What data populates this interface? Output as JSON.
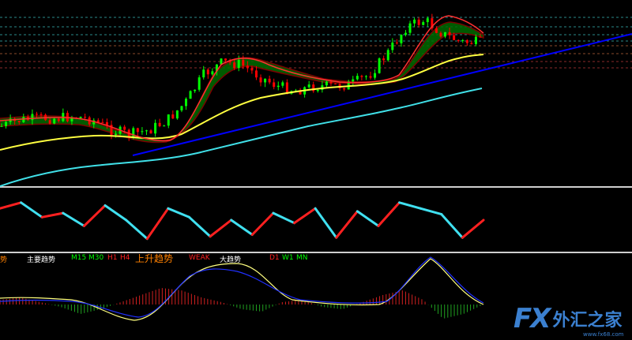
{
  "chart_data": [
    {
      "type": "line",
      "panel": "price",
      "series": [
        {
          "values": [
            1.3,
            1.33,
            1.34,
            1.34,
            1.35,
            1.33,
            1.28,
            1.26,
            1.28,
            1.33,
            1.42,
            1.56,
            1.62,
            1.61,
            1.55,
            1.5,
            1.48,
            1.5,
            1.5,
            1.51,
            1.56,
            1.67,
            1.8,
            1.83,
            1.76,
            1.72,
            1.72
          ]
        },
        {
          "values": [
            1.2,
            1.23,
            1.25,
            1.27,
            1.28,
            1.29,
            1.28,
            1.27,
            1.27,
            1.3,
            1.36,
            1.44,
            1.5,
            1.53,
            1.54,
            1.54,
            1.55,
            1.56,
            1.56,
            1.58,
            1.62,
            1.68,
            1.74,
            1.76,
            1.76
          ]
        },
        {
          "values": [
            1.0,
            1.04,
            1.07,
            1.1,
            1.13,
            1.16,
            1.19,
            1.22,
            1.25,
            1.28,
            1.31,
            1.34,
            1.37,
            1.4,
            1.43,
            1.46,
            1.49,
            1.52,
            1.54
          ]
        },
        {
          "values": [
            1.0,
            1.73
          ]
        }
      ]
    },
    {
      "type": "line",
      "panel": "oscillator",
      "series": [
        {
          "values": [
            70,
            80,
            55,
            62,
            40,
            75,
            50,
            18,
            70,
            55,
            22,
            50,
            25,
            62,
            45,
            70,
            20,
            65,
            40,
            80,
            70,
            60,
            20,
            50
          ]
        }
      ]
    },
    {
      "type": "bar",
      "panel": "histogram",
      "series": [
        {
          "values": [
            0.2,
            0.3,
            0.1,
            -0.1,
            -0.4,
            -0.2,
            0.1,
            0.4,
            0.7,
            0.6,
            0.3,
            0.1,
            -0.2,
            -0.3,
            0.1,
            0.2,
            -0.1,
            -0.2,
            0.1,
            0.4,
            0.6,
            0.2,
            -0.6,
            -0.4,
            0.0
          ]
        }
      ]
    }
  ],
  "colors": {
    "background": "#000000",
    "up_candle": "#00ff00",
    "down_candle": "#ff0000",
    "ma_fast": "#ff3030",
    "ma_cloud_up": "#008000",
    "ma_cloud_down": "#7a0000",
    "ma_mid": "#ffff40",
    "ma_slow": "#40e0e8",
    "trendline": "#0000ff",
    "macd_line": "#ffff80",
    "signal_line": "#2030ff"
  },
  "labels": {
    "trend_partial": "势",
    "main_trend": "主要趋势",
    "m15": "M15",
    "m30": "M30",
    "h1": "H1",
    "h4": "H4",
    "uptrend": "上升趋势",
    "weak": "WEAK",
    "big_trend": "大趋势",
    "d1": "D1",
    "w1": "W1",
    "mn": "MN"
  },
  "watermark": {
    "brand": "FX",
    "name": "外汇之家",
    "url": "www.fx68.com"
  }
}
